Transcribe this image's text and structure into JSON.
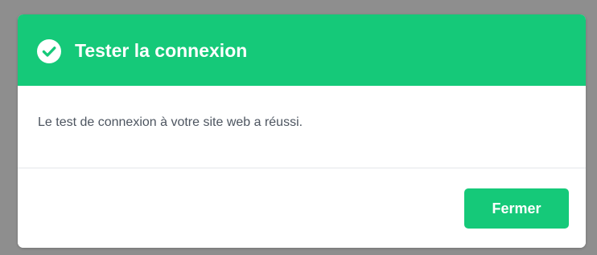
{
  "dialog": {
    "title": "Tester la connexion",
    "icon": "check-circle-icon",
    "message": "Le test de connexion à votre site web a réussi.",
    "close_label": "Fermer"
  },
  "colors": {
    "accent": "#15c979",
    "text": "#4d5560",
    "backdrop": "#8e8e8e"
  }
}
